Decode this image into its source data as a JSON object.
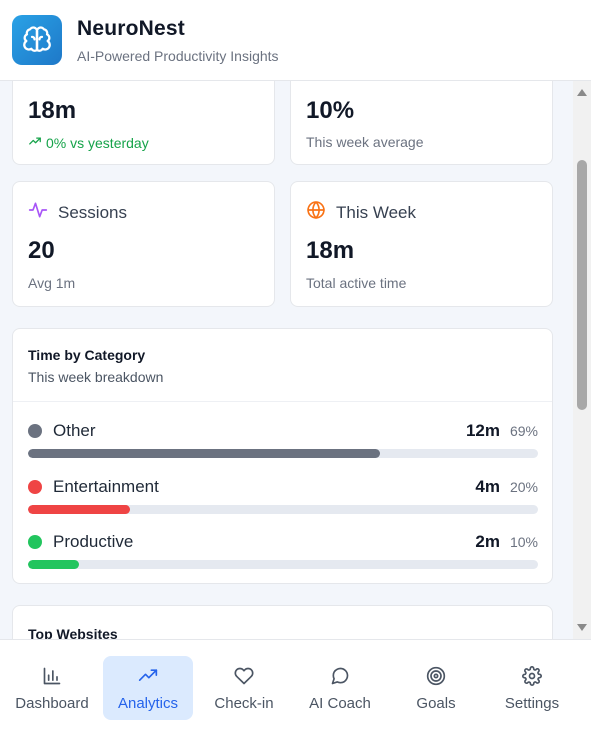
{
  "app": {
    "title": "NeuroNest",
    "subtitle": "AI-Powered Productivity Insights",
    "icon": "brain-icon"
  },
  "stats": {
    "today": {
      "value": "18m",
      "sub": "0% vs yesterday",
      "icon": "trending-up-icon"
    },
    "focus": {
      "value": "10%",
      "sub": "This week average"
    },
    "sessions": {
      "label": "Sessions",
      "value": "20",
      "sub": "Avg 1m",
      "icon": "activity-icon"
    },
    "week": {
      "label": "This Week",
      "value": "18m",
      "sub": "Total active time",
      "icon": "globe-icon"
    }
  },
  "categories": {
    "title": "Time by Category",
    "subtitle": "This week breakdown",
    "items": [
      {
        "name": "Other",
        "time": "12m",
        "pct": "69%",
        "fraction": 0.69,
        "color": "#6b7280"
      },
      {
        "name": "Entertainment",
        "time": "4m",
        "pct": "20%",
        "fraction": 0.2,
        "color": "#ef4444"
      },
      {
        "name": "Productive",
        "time": "2m",
        "pct": "10%",
        "fraction": 0.1,
        "color": "#22c55e"
      }
    ]
  },
  "websites": {
    "title": "Top Websites"
  },
  "nav": {
    "items": [
      {
        "label": "Dashboard",
        "icon": "bar-chart-icon",
        "active": false
      },
      {
        "label": "Analytics",
        "icon": "trending-up-icon",
        "active": true
      },
      {
        "label": "Check-in",
        "icon": "heart-icon",
        "active": false
      },
      {
        "label": "AI Coach",
        "icon": "message-circle-icon",
        "active": false
      },
      {
        "label": "Goals",
        "icon": "target-icon",
        "active": false
      },
      {
        "label": "Settings",
        "icon": "gear-icon",
        "active": false
      }
    ]
  },
  "colors": {
    "accent": "#2563eb",
    "active_bg": "#dbeafe",
    "positive": "#16a34a",
    "sessions_icon": "#a855f7",
    "week_icon": "#f97316"
  }
}
